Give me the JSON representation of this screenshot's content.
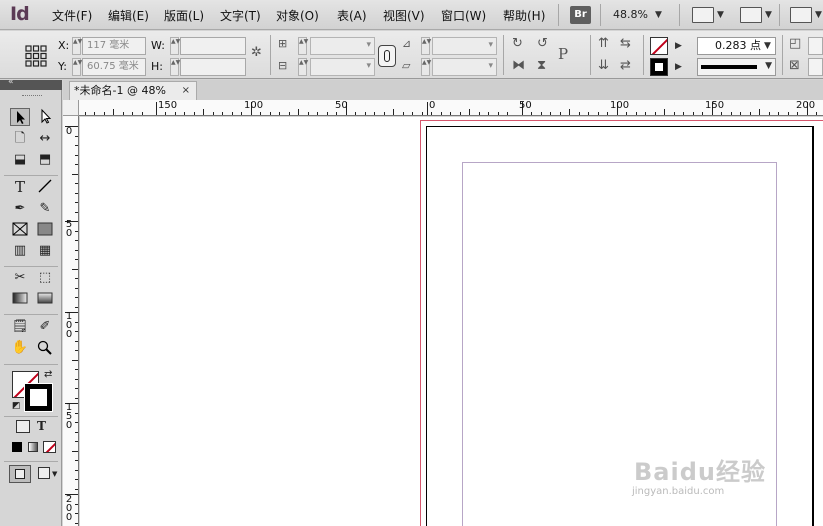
{
  "app": {
    "logo": "Id"
  },
  "menu": {
    "items": [
      "文件(F)",
      "编辑(E)",
      "版面(L)",
      "文字(T)",
      "对象(O)",
      "表(A)",
      "视图(V)",
      "窗口(W)",
      "帮助(H)"
    ],
    "bridge_badge": "Br",
    "zoom": "48.8%"
  },
  "control": {
    "x_label": "X:",
    "y_label": "Y:",
    "w_label": "W:",
    "h_label": "H:",
    "x_value": "117 毫米",
    "y_value": "60.75 毫米",
    "w_value": "",
    "h_value": "",
    "stroke_weight": "0.283 点",
    "text_frame_icon": "P"
  },
  "document": {
    "tab_title": "*未命名-1 @ 48%",
    "tab_close": "×"
  },
  "rulers": {
    "horizontal_labels": [
      "150",
      "100",
      "50",
      "0",
      "50",
      "100",
      "150",
      "200"
    ],
    "vertical_labels": [
      [
        "0"
      ],
      [
        "5",
        "0"
      ],
      [
        "1",
        "0",
        "0"
      ],
      [
        "1",
        "5",
        "0"
      ],
      [
        "2",
        "0",
        "0"
      ]
    ]
  },
  "toolbox": {
    "type_tool_label": "T",
    "format_text_label": "T"
  },
  "watermark": {
    "main": "Baidu经验",
    "sub": "jingyan.baidu.com"
  },
  "colors": {
    "menubar_bg": "#d8d8d8",
    "bleed_guide": "#d5566c",
    "margin_guide": "#b7a6c6",
    "logo": "#5b3a55"
  }
}
